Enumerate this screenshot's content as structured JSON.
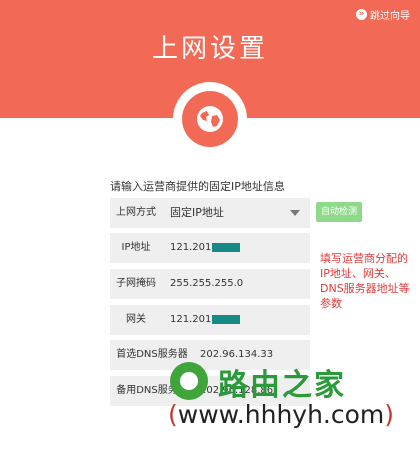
{
  "header": {
    "skip_label": "跳过向导",
    "title": "上网设置",
    "bg_color": "#f26a55"
  },
  "form": {
    "prompt": "请输入运营商提供的固定IP地址信息",
    "mode_label": "上网方式",
    "mode_value": "固定IP地址",
    "detect_button": "自动检测",
    "ip_label": "IP地址",
    "ip_value": "121.201",
    "mask_label": "子网掩码",
    "mask_value": "255.255.255.0",
    "gateway_label": "网关",
    "gateway_value": "121.201",
    "dns1_label": "首选DNS服务器",
    "dns1_value": "202.96.134.33",
    "dns2_label": "备用DNS服务器",
    "dns2_value": "202.96.128.86"
  },
  "annotation": {
    "text": "填写运营商分配的IP地址、网关、DNS服务器地址等参数",
    "color": "#e03a3a"
  },
  "watermark": {
    "name": "路由之家",
    "url_open": "(",
    "url": "www.hhhyh.com",
    "url_close": ")"
  }
}
